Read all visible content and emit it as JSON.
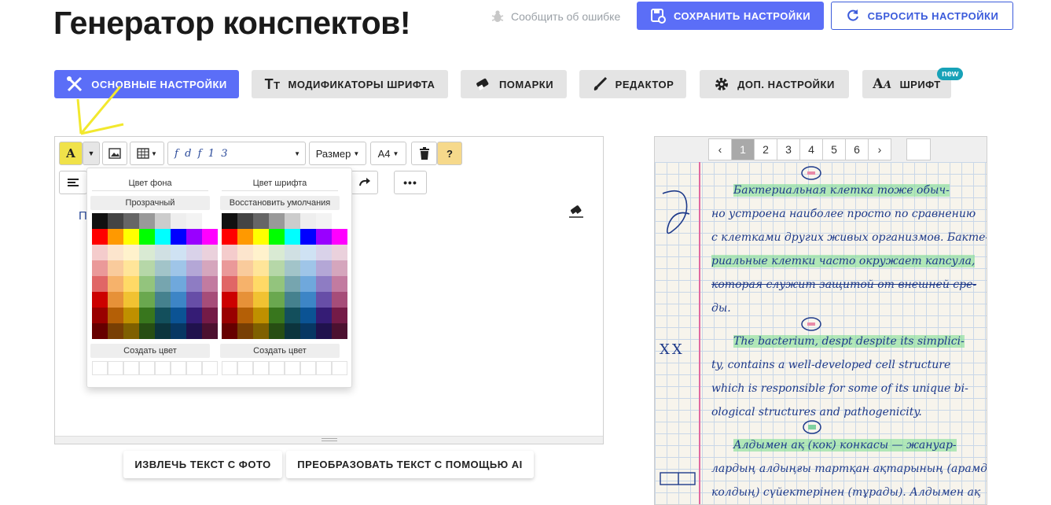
{
  "title": "Генератор конспектов!",
  "header": {
    "report": "Сообщить об ошибке",
    "save": "СОХРАНИТЬ НАСТРОЙКИ",
    "reset": "СБРОСИТЬ НАСТРОЙКИ"
  },
  "tabs": [
    {
      "label": "ОСНОВНЫЕ НАСТРОЙКИ",
      "icon": "tools-icon",
      "active": true
    },
    {
      "label": "МОДИФИКАТОРЫ ШРИФТА",
      "icon": "text-size-icon",
      "active": false
    },
    {
      "label": "ПОМАРКИ",
      "icon": "eraser-icon",
      "active": false
    },
    {
      "label": "РЕДАКТОР",
      "icon": "brush-icon",
      "active": false
    },
    {
      "label": "ДОП. НАСТРОЙКИ",
      "icon": "gear-icon",
      "active": false
    },
    {
      "label": "ШРИФТ",
      "icon": "font-icon",
      "active": false,
      "badge": "new"
    }
  ],
  "toolbar": {
    "highlight_glyph": "A",
    "font_samples": "f  d  f  1  3",
    "size_label": "Размер",
    "paper_label": "A4",
    "help_label": "?"
  },
  "editor": {
    "first_char": "П"
  },
  "color_picker": {
    "bg_title": "Цвет фона",
    "bg_button": "Прозрачный",
    "font_title": "Цвет шрифта",
    "font_button": "Восстановить умолчания",
    "create_label": "Создать цвет",
    "colors": [
      [
        "#111111",
        "#444444",
        "#666666",
        "#999999",
        "#cccccc",
        "#eeeeee",
        "#f3f3f3",
        "#ffffff"
      ],
      [
        "#ff0000",
        "#ff9900",
        "#ffff00",
        "#00ff00",
        "#00ffff",
        "#0000ff",
        "#9900ff",
        "#ff00ff"
      ],
      [
        "#f4cccc",
        "#fce5cd",
        "#fff2cc",
        "#d9ead3",
        "#d0e0e3",
        "#cfe2f3",
        "#d9d2e9",
        "#ead1dc"
      ],
      [
        "#ea9999",
        "#f9cb9c",
        "#ffe599",
        "#b6d7a8",
        "#a2c4c9",
        "#9fc5e8",
        "#b4a7d6",
        "#d5a6bd"
      ],
      [
        "#e06666",
        "#f6b26b",
        "#ffd966",
        "#93c47d",
        "#76a5af",
        "#6fa8dc",
        "#8e7cc3",
        "#c27ba0"
      ],
      [
        "#cc0000",
        "#e69138",
        "#f1c232",
        "#6aa84f",
        "#45818e",
        "#3d85c6",
        "#674ea7",
        "#a64d79"
      ],
      [
        "#990000",
        "#b45f06",
        "#bf9000",
        "#38761d",
        "#134f5c",
        "#0b5394",
        "#351c75",
        "#741b47"
      ],
      [
        "#660000",
        "#783f04",
        "#7f6000",
        "#274e13",
        "#0c343d",
        "#073763",
        "#20124d",
        "#4c1130"
      ]
    ]
  },
  "actions": {
    "extract": "ИЗВЛЕЧЬ ТЕКСТ С ФОТО",
    "transform": "ПРЕОБРАЗОВАТЬ ТЕКСТ С ПОМОЩЬЮ AI"
  },
  "pagination": {
    "prev": "‹",
    "pages": [
      "1",
      "2",
      "3",
      "4",
      "5",
      "6"
    ],
    "active": "1",
    "next": "›"
  },
  "notebook_lines": [
    "Бактериальная клетка тоже обыч-",
    "но устроена наиболее просто по сравнению",
    "с клетками других живых организмов. Бакте-",
    "риальные клетки часто окружает капсула,",
    "которая служит защитой от внешней сре-",
    "ды.",
    "The bacterium, despt despite its simplici-",
    "ty, contains a well-developed cell structure",
    "which is responsible for some of its unique bi-",
    "ological structures and pathogenicity.",
    "Алдымен ақ (кок) конкасы — жануар-",
    "лардың алдыңғы тартқан ақтарының (арамда",
    "колдың) сүйектерінен (тұрады). Алдымен ақ"
  ],
  "notebook_margin_marks": [
    "XX"
  ]
}
